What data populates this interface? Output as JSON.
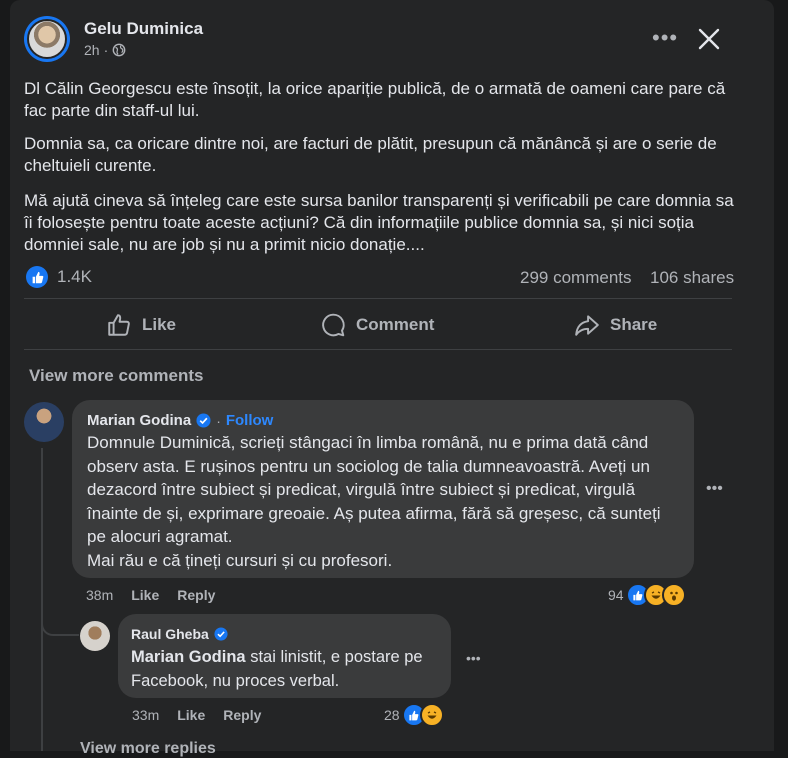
{
  "post": {
    "author": "Gelu Duminica",
    "time": "2h",
    "paragraphs": [
      "Dl Călin Georgescu este însoțit, la orice apariție publică, de o armată de oameni care pare că fac parte din staff-ul lui.",
      "Domnia sa, ca oricare dintre noi, are facturi de plătit, presupun că mănâncă și are o serie de cheltuieli curente.",
      "Mă ajută cineva să înțeleg care este sursa banilor transparenți și verificabili pe care domnia sa îi folosește pentru toate aceste acțiuni? Că din informațiile publice domnia sa, și nici soția domniei sale,  nu are job și nu a primit nicio donație...."
    ],
    "reactions_count": "1.4K",
    "comments_count": "299 comments",
    "shares_count": "106 shares"
  },
  "actions": {
    "like": "Like",
    "comment": "Comment",
    "share": "Share"
  },
  "view_more_comments": "View more comments",
  "comment1": {
    "author": "Marian Godina",
    "follow": "Follow",
    "text_lines": [
      "Domnule Duminică, scrieți stângaci în limba română, nu e prima dată când",
      "observ asta. E rușinos pentru un sociolog de talia dumneavoastră. Aveți un",
      "dezacord între subiect și predicat, virgulă între subiect și predicat, virgulă",
      "înainte de și, exprimare greoaie. Aș putea afirma, fără să greșesc, că sunteți",
      "pe alocuri agramat.",
      "Mai rău e că țineți cursuri și cu profesori."
    ],
    "time": "38m",
    "like": "Like",
    "reply": "Reply",
    "reaction_count": "94",
    "reaction_icons": [
      "like-icon",
      "laughing-emoji-icon",
      "wow-emoji-icon"
    ]
  },
  "reply1": {
    "author": "Raul Gheba",
    "mention": "Marian Godina",
    "text_line1": " stai linistit, e postare pe",
    "text_line2": "Facebook, nu proces verbal.",
    "time": "33m",
    "like": "Like",
    "reply": "Reply",
    "reaction_count": "28",
    "reaction_icons": [
      "like-icon",
      "laughing-emoji-icon"
    ]
  },
  "view_more_replies": "View more replies",
  "colors": {
    "card": "#242526",
    "bubble": "#3a3b3c",
    "accent": "#1877f2",
    "text": "#e4e6eb",
    "secondary": "#b0b3b8",
    "follow": "#2d88ff"
  }
}
